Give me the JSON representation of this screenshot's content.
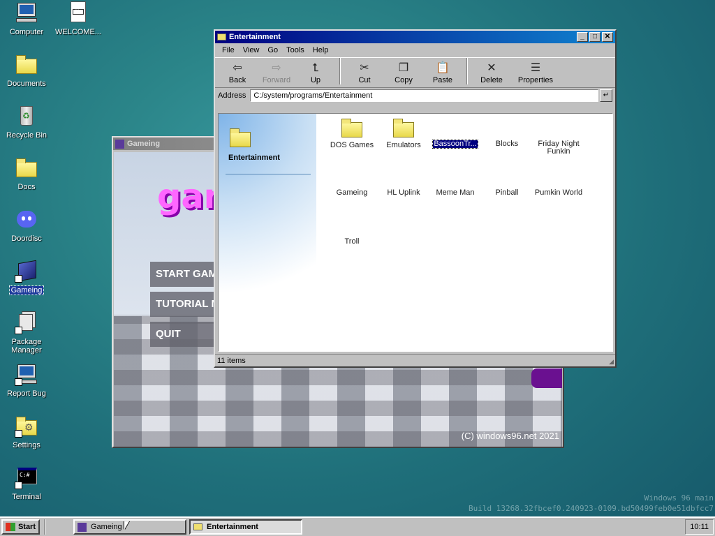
{
  "desktop": {
    "icons": [
      {
        "label": "Computer",
        "icon": "computer-icon"
      },
      {
        "label": "WELCOME...",
        "icon": "markdown-file-icon"
      },
      {
        "label": "Documents",
        "icon": "documents-folder-icon"
      },
      {
        "label": "Recycle Bin",
        "icon": "recycle-bin-icon"
      },
      {
        "label": "Docs",
        "icon": "folder-icon"
      },
      {
        "label": "Doordisc",
        "icon": "discord-icon"
      },
      {
        "label": "Gameing",
        "icon": "cube-icon"
      },
      {
        "label": "Package Manager",
        "icon": "package-icon"
      },
      {
        "label": "Report Bug",
        "icon": "computer-icon"
      },
      {
        "label": "Settings",
        "icon": "settings-icon"
      },
      {
        "label": "Terminal",
        "icon": "terminal-icon"
      }
    ],
    "watermark": {
      "line1": "Windows 96 main",
      "line2": "Build 13268.32fbcef0.240923-0109.bd50499feb0e51dbfcc7"
    }
  },
  "gameing_window": {
    "title": "Gameing",
    "logo_text": "gam",
    "menu": [
      "START GAME",
      "TUTORIAL M",
      "QUIT"
    ],
    "copyright": "(C) windows96.net 2021"
  },
  "explorer": {
    "title": "Entertainment",
    "menu": [
      "File",
      "View",
      "Go",
      "Tools",
      "Help"
    ],
    "toolbar": [
      {
        "label": "Back",
        "glyph": "⇦",
        "enabled": true
      },
      {
        "label": "Forward",
        "glyph": "⇨",
        "enabled": false
      },
      {
        "label": "Up",
        "glyph": "⮤",
        "enabled": true
      },
      {
        "label": "Cut",
        "glyph": "✂",
        "enabled": true
      },
      {
        "label": "Copy",
        "glyph": "❐",
        "enabled": true
      },
      {
        "label": "Paste",
        "glyph": "📋",
        "enabled": true
      },
      {
        "label": "Delete",
        "glyph": "✕",
        "enabled": true
      },
      {
        "label": "Properties",
        "glyph": "☰",
        "enabled": true
      }
    ],
    "address_label": "Address",
    "address_value": "C:/system/programs/Entertainment",
    "side_title": "Entertainment",
    "items": [
      {
        "label": "DOS Games",
        "type": "folder"
      },
      {
        "label": "Emulators",
        "type": "folder"
      },
      {
        "label": "BassoonTr...",
        "type": "app",
        "selected": true
      },
      {
        "label": "Blocks",
        "type": "app"
      },
      {
        "label": "Friday Night Funkin",
        "type": "app"
      },
      {
        "label": "Gameing",
        "type": "app"
      },
      {
        "label": "HL Uplink",
        "type": "app"
      },
      {
        "label": "Meme Man",
        "type": "app"
      },
      {
        "label": "Pinball",
        "type": "app"
      },
      {
        "label": "Pumkin World",
        "type": "app"
      },
      {
        "label": "Troll",
        "type": "app"
      }
    ],
    "status": "11 items"
  },
  "taskbar": {
    "start_label": "Start",
    "tasks": [
      {
        "label": "Gameing",
        "active": false
      },
      {
        "label": "Entertainment",
        "active": true
      }
    ],
    "clock": "10:11"
  }
}
